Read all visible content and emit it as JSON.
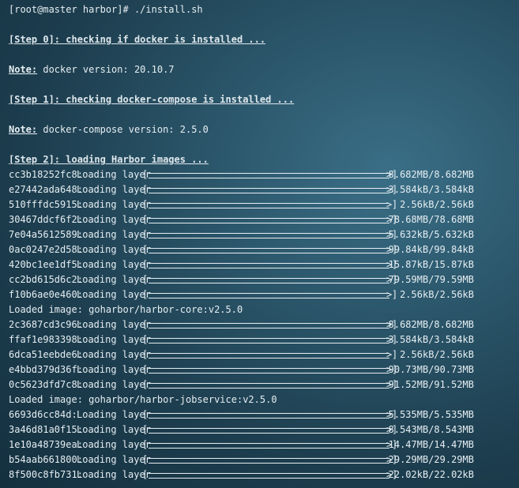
{
  "prompt_line": "[root@master harbor]# ./install.sh",
  "steps": {
    "step0": "[Step 0]: checking if docker is installed ...",
    "step1": "[Step 1]: checking docker-compose is installed ...",
    "step2": "[Step 2]: loading Harbor images ..."
  },
  "notes": {
    "label": "Note:",
    "docker": " docker version: 20.10.7",
    "compose": " docker-compose version: 2.5.0"
  },
  "loading_text": "Loading layer",
  "bar_open": "[",
  "bar_head": ">",
  "bar_close": "]",
  "layer_groups": [
    {
      "layers": [
        {
          "id": "cc3b18252fc8:",
          "progress": 1.0,
          "size": "8.682MB/8.682MB"
        },
        {
          "id": "e27442ada648:",
          "progress": 1.0,
          "size": "3.584kB/3.584kB"
        },
        {
          "id": "510fffdc5915:",
          "progress": 1.0,
          "size": "2.56kB/2.56kB"
        },
        {
          "id": "30467ddcf6f2:",
          "progress": 1.0,
          "size": "78.68MB/78.68MB"
        },
        {
          "id": "7e04a5612589:",
          "progress": 1.0,
          "size": "5.632kB/5.632kB"
        },
        {
          "id": "0ac0247e2d58:",
          "progress": 1.0,
          "size": "99.84kB/99.84kB"
        },
        {
          "id": "420bc1ee1df5:",
          "progress": 1.0,
          "size": "15.87kB/15.87kB"
        },
        {
          "id": "cc2bd615d6c2:",
          "progress": 1.0,
          "size": "79.59MB/79.59MB"
        },
        {
          "id": "f10b6ae0e460:",
          "progress": 1.0,
          "size": "2.56kB/2.56kB"
        }
      ],
      "loaded_image": "Loaded image: goharbor/harbor-core:v2.5.0"
    },
    {
      "layers": [
        {
          "id": "2c3687cd3c96:",
          "progress": 1.0,
          "size": "8.682MB/8.682MB"
        },
        {
          "id": "ffaf1e983398:",
          "progress": 1.0,
          "size": "3.584kB/3.584kB"
        },
        {
          "id": "6dca51eebde6:",
          "progress": 1.0,
          "size": "2.56kB/2.56kB"
        },
        {
          "id": "e4bbd379d36f:",
          "progress": 1.0,
          "size": "90.73MB/90.73MB"
        },
        {
          "id": "0c5623dfd7c8:",
          "progress": 1.0,
          "size": "91.52MB/91.52MB"
        }
      ],
      "loaded_image": "Loaded image: goharbor/harbor-jobservice:v2.5.0"
    },
    {
      "layers": [
        {
          "id": "6693d6cc84d:",
          "progress": 1.0,
          "size": "5.535MB/5.535MB"
        },
        {
          "id": "3a46d81a0f15:",
          "progress": 1.0,
          "size": "8.543MB/8.543MB"
        },
        {
          "id": "1e10a48739ea:",
          "progress": 1.0,
          "size": "14.47MB/14.47MB"
        },
        {
          "id": "b54aab661800:",
          "progress": 1.0,
          "size": "29.29MB/29.29MB"
        },
        {
          "id": "8f500c8fb731:",
          "progress": 1.0,
          "size": "22.02kB/22.02kB"
        }
      ],
      "loaded_image": ""
    }
  ],
  "colors": {
    "text": "#e6eef2",
    "background": "#2a5468"
  }
}
